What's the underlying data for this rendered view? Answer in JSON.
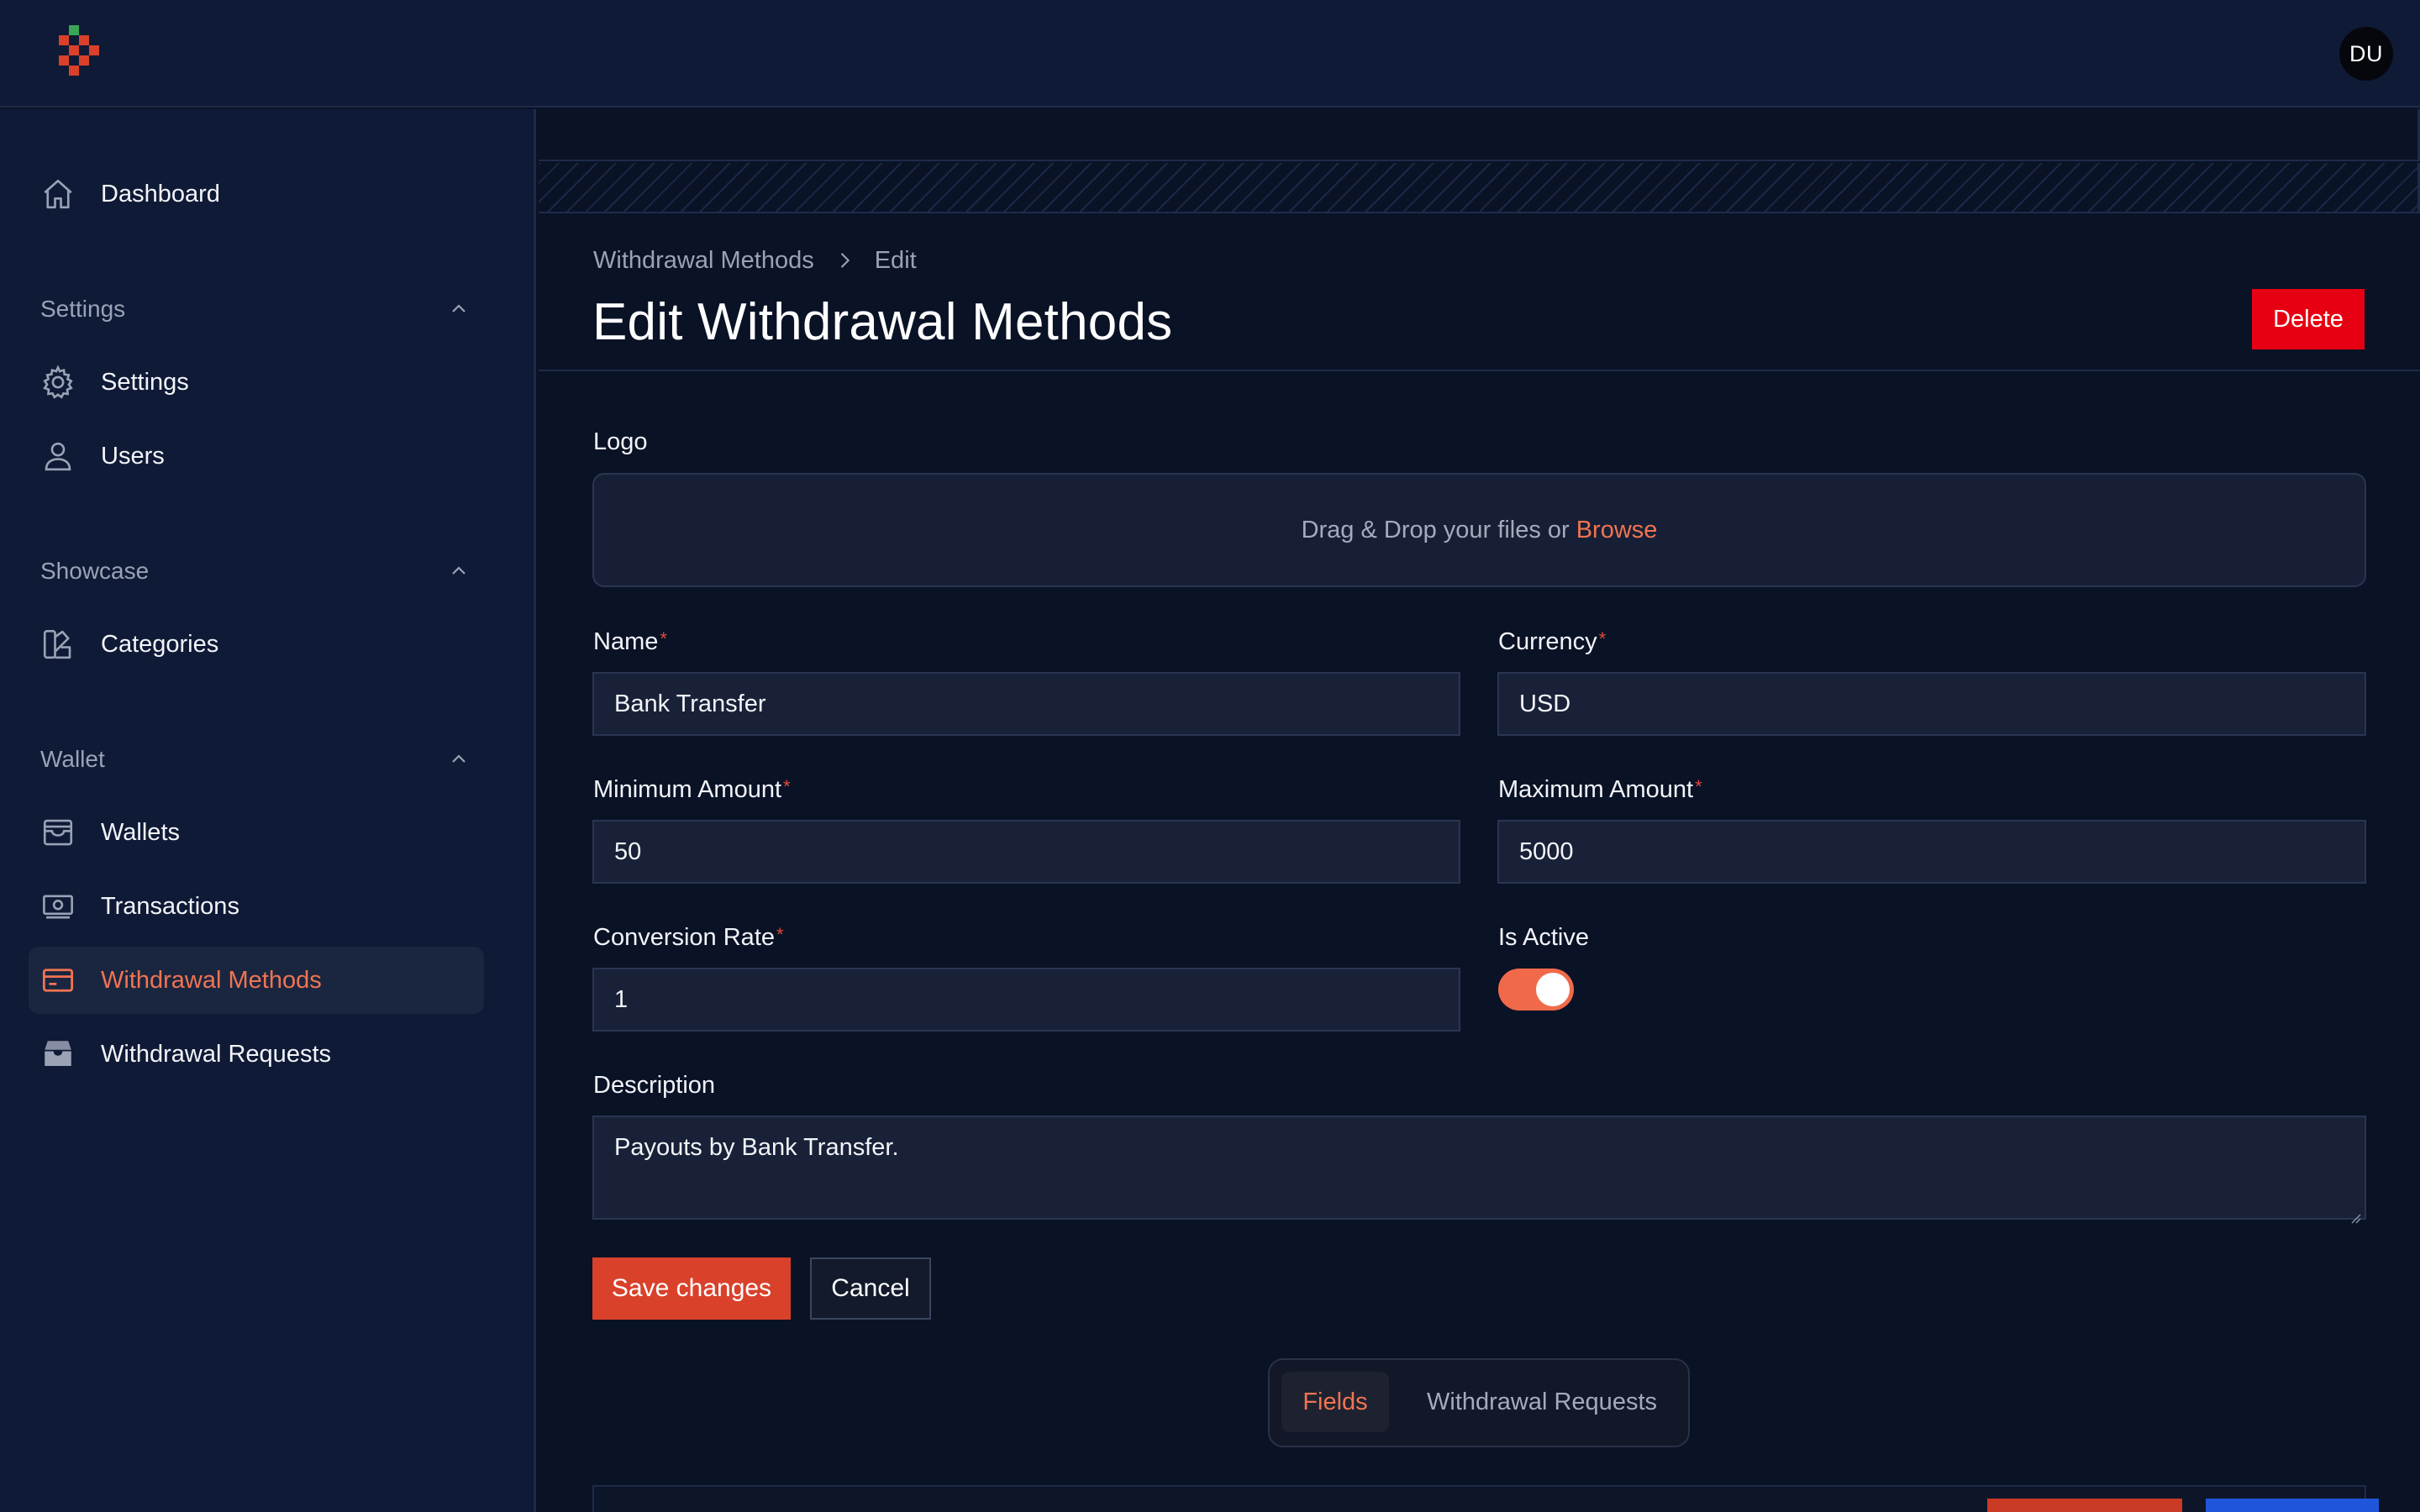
{
  "topbar": {
    "avatar_initials": "DU"
  },
  "sidebar": {
    "dashboard": "Dashboard",
    "groups": [
      {
        "label": "Settings",
        "items": [
          "Settings",
          "Users"
        ]
      },
      {
        "label": "Showcase",
        "items": [
          "Categories"
        ]
      },
      {
        "label": "Wallet",
        "items": [
          "Wallets",
          "Transactions",
          "Withdrawal Methods",
          "Withdrawal Requests"
        ]
      }
    ],
    "active_item": "Withdrawal Methods"
  },
  "header": {
    "breadcrumb": [
      "Withdrawal Methods",
      "Edit"
    ],
    "title": "Edit Withdrawal Methods",
    "delete_label": "Delete"
  },
  "form": {
    "logo_label": "Logo",
    "dropzone_text": "Drag & Drop your files or",
    "dropzone_browse": "Browse",
    "name_label": "Name",
    "name_value": "Bank Transfer",
    "currency_label": "Currency",
    "currency_value": "USD",
    "min_label": "Minimum Amount",
    "min_value": "50",
    "max_label": "Maximum Amount",
    "max_value": "5000",
    "rate_label": "Conversion Rate",
    "rate_value": "1",
    "active_label": "Is Active",
    "is_active": true,
    "description_label": "Description",
    "description_value": "Payouts by Bank Transfer.",
    "required_marker": "*",
    "save_label": "Save changes",
    "cancel_label": "Cancel"
  },
  "relation_tabs": {
    "tabs": [
      "Fields",
      "Withdrawal Requests"
    ],
    "active": "Fields"
  },
  "colors": {
    "accent": "#f07451",
    "primary_button": "#d9412b",
    "danger_button": "#e60012",
    "background": "#0b1225",
    "sidebar": "#0f1a36"
  }
}
